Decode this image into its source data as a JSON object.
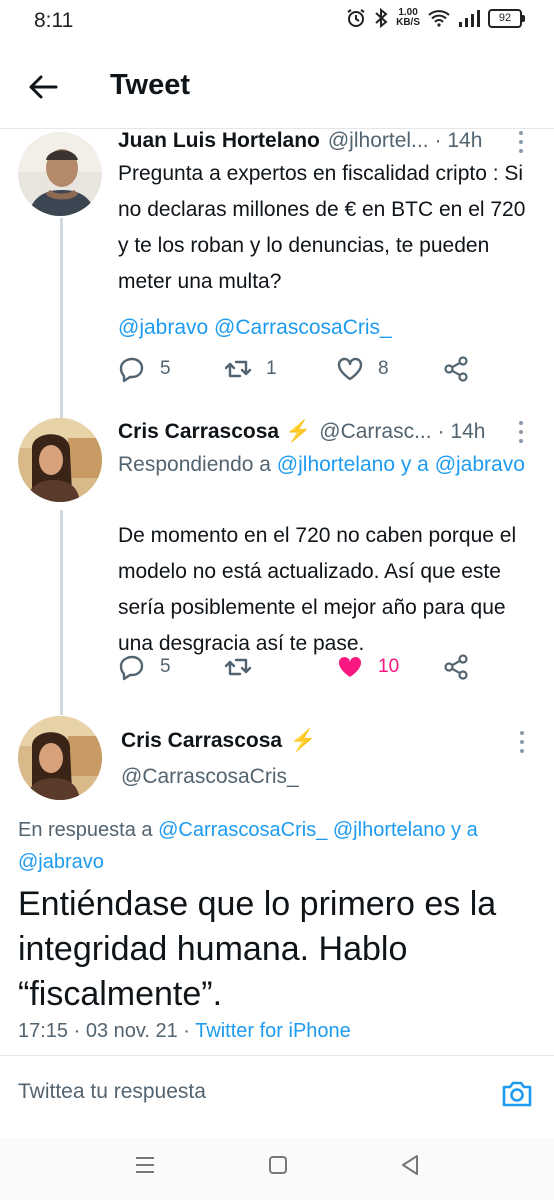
{
  "status_bar": {
    "time": "8:11",
    "speed_value": "1.00",
    "speed_unit": "KB/S",
    "battery": "92"
  },
  "header": {
    "title": "Tweet"
  },
  "tweets": [
    {
      "name": "Juan Luis Hortelano",
      "handle": "@jlhortel...",
      "time": "· 14h",
      "text": "Pregunta a expertos en fiscalidad cripto : Si no declaras millones de € en BTC en el 720 y te los roban y lo denuncias, te pueden meter una multa?",
      "mentions": "@jabravo @CarrascosaCris_",
      "replies": "5",
      "retweets": "1",
      "likes": "8"
    },
    {
      "name": "Cris Carrascosa",
      "badge": "⚡",
      "handle": "@Carrasc...",
      "time": "· 14h",
      "replying_prefix": "Respondiendo a ",
      "replying_users": "@jlhortelano y a @jabravo",
      "text": "De momento en el 720 no caben porque el modelo no está actualizado. Así que este sería posiblemente el mejor año para que una desgracia así te pase.",
      "replies": "5",
      "retweets": "",
      "likes": "10"
    }
  ],
  "main_tweet": {
    "name": "Cris Carrascosa",
    "badge": "⚡",
    "handle": "@CarrascosaCris_",
    "reply_prefix": "En respuesta a ",
    "reply_users": "@CarrascosaCris_ @jlhortelano y a @jabravo",
    "text": "Entiéndase que lo primero es la integridad humana. Hablo “fiscalmente”.",
    "datetime": "17:15 · 03 nov. 21 · ",
    "source": "Twitter for iPhone"
  },
  "reply_box": {
    "placeholder": "Twittea tu respuesta"
  },
  "colors": {
    "link": "#1d9bf0",
    "like_active": "#f91880",
    "badge": "#f5a623"
  },
  "icons": [
    "back-arrow-icon",
    "reply-icon",
    "retweet-icon",
    "like-icon",
    "share-icon",
    "camera-icon",
    "more-icon"
  ]
}
